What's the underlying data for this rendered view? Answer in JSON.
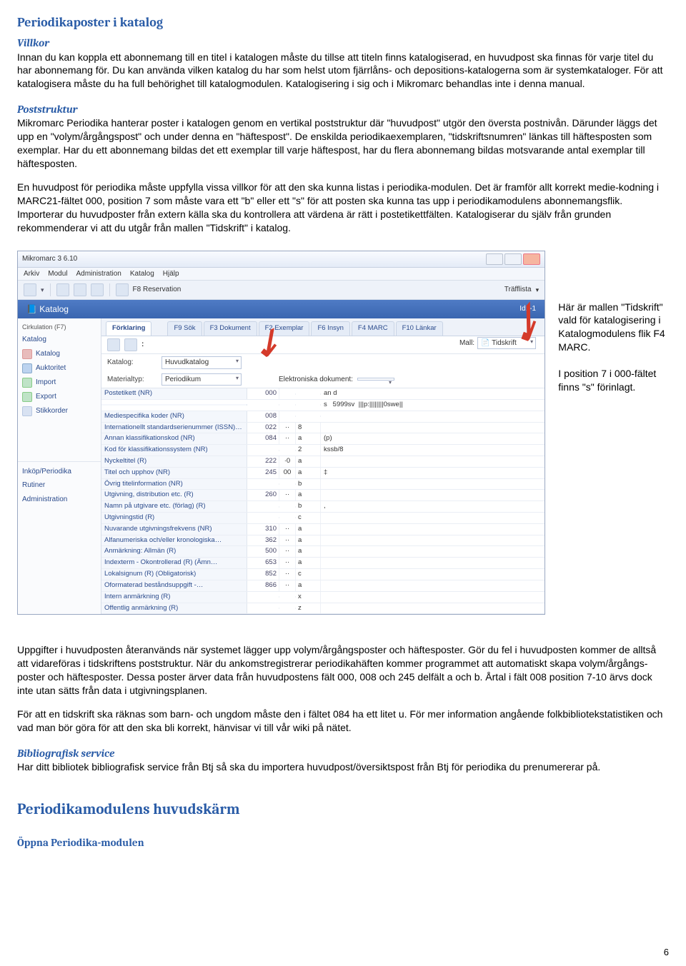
{
  "heading_main": "Periodikaposter i katalog",
  "villkor": {
    "heading": "Villkor",
    "para": "Innan du kan koppla ett abonnemang till en titel i katalogen måste du tillse att titeln finns katalogiserad, en huvudpost ska finnas för varje titel du har abonnemang för. Du kan använda vilken katalog du har som helst utom fjärrlåns- och depositions-katalogerna som är systemkataloger. För att katalogisera måste du ha full behörighet till katalogmodulen. Katalogisering i sig och i Mikromarc behandlas inte i denna manual."
  },
  "poststruktur": {
    "heading": "Poststruktur",
    "p1": "Mikromarc Periodika hanterar poster i katalogen genom en vertikal poststruktur där \"huvudpost\" utgör den översta postnivån. Därunder läggs det upp en \"volym/årgångspost\" och under denna en \"häftespost\". De enskilda periodikaexemplaren, \"tidskriftsnumren\" länkas till häftesposten som exemplar. Har du ett abonnemang bildas det ett exemplar till varje häftespost, har du flera abonnemang bildas motsvarande antal exemplar till häftesposten.",
    "p2": "En huvudpost för periodika måste uppfylla vissa villkor för att den ska kunna listas i periodika-modulen. Det är framför allt korrekt medie-kodning i MARC21-fältet 000, position 7 som måste vara ett \"b\" eller ett \"s\" för att posten ska kunna tas upp i periodikamodulens abonnemangsflik. Importerar du huvudposter från extern källa ska du kontrollera att värdena är rätt i postetikettfälten. Katalogiserar du själv från grunden rekommenderar vi att du utgår från mallen \"Tidskrift\" i katalog."
  },
  "side_notes": {
    "n1": "Här är mallen \"Tidskrift\" vald för katalogisering i Katalogmodulens flik F4 MARC.",
    "n2": "I position 7 i 000-fältet finns \"s\" förinlagt."
  },
  "below": {
    "p1": "Uppgifter i huvudposten återanvänds när systemet lägger upp volym/årgångsposter och häftesposter. Gör du fel i huvudposten kommer de alltså att vidareföras i tidskriftens poststruktur. När du ankomstregistrerar periodikahäften kommer programmet att automatiskt skapa volym/årgångs-poster och häftesposter. Dessa poster ärver data från huvudpostens fält 000, 008 och 245 delfält a och b. Årtal i fält 008 position 7-10 ärvs dock inte utan sätts från data i utgivningsplanen.",
    "p2": "För att en tidskrift ska räknas som barn- och ungdom måste den i fältet 084 ha ett litet u. För mer information angående folkbibliotekstatistiken och vad man bör göra för att den ska bli korrekt, hänvisar vi till vår wiki på nätet."
  },
  "biblio": {
    "heading": "Bibliografisk service",
    "p": "Har ditt bibliotek bibliografisk service från Btj så ska du importera huvudpost/översiktspost från Btj för periodika du prenumererar på."
  },
  "section2": {
    "heading": "Periodikamodulens huvudskärm",
    "sub": "Öppna Periodika-modulen"
  },
  "app": {
    "title": "Mikromarc 3 6.10",
    "menus": [
      "Arkiv",
      "Modul",
      "Administration",
      "Katalog",
      "Hjälp"
    ],
    "toolbar": {
      "f8": "F8 Reservation",
      "traff": "Träfflista"
    },
    "katalog_header_left": "Katalog",
    "katalog_header_right": "Id: -1",
    "sidebar_top_label": "Cirkulation (F7)",
    "sidebar_items": [
      "Katalog",
      "Katalog",
      "Auktoritet",
      "Import",
      "Export",
      "Stikkorder"
    ],
    "sidebar_bottom": [
      "Inköp/Periodika",
      "Rutiner",
      "Administration"
    ],
    "tab_first": "Förklaring",
    "tabs": [
      "F9 Sök",
      "F3 Dokument",
      "F2 Exemplar",
      "F6 Insyn",
      "F4 MARC",
      "F10 Länkar"
    ],
    "form": {
      "katalog_lbl": "Katalog:",
      "katalog_val": "Huvudkatalog",
      "mat_lbl": "Materialtyp:",
      "mat_val": "Periodikum",
      "edok_lbl": "Elektroniska dokument:",
      "mall_lbl": "Mall:",
      "mall_val": "Tidskrift"
    },
    "grid": [
      {
        "name": "Postetikett (NR)",
        "tag": "000",
        "ind": "",
        "s": "",
        "sub": "an d"
      },
      {
        "name": "",
        "tag": "",
        "ind": "",
        "s": "",
        "sub": "s ‎ ‎ ‎5999sv ‎ |||p:||||||||0swe||"
      },
      {
        "name": "Mediespecifika koder (NR)",
        "tag": "008",
        "ind": "",
        "s": "",
        "sub": ""
      },
      {
        "name": "Internationellt standardserienummer (ISSN)…",
        "tag": "022",
        "ind": "··",
        "s": "8",
        "sub": ""
      },
      {
        "name": "Annan klassifikationskod (NR)",
        "tag": "084",
        "ind": "··",
        "s": "a",
        "sub": "(p)"
      },
      {
        "name": "Kod för klassifikationssystem (NR)",
        "tag": "",
        "ind": "",
        "s": "2",
        "sub": "kssb/8"
      },
      {
        "name": "Nyckeltitel (R)",
        "tag": "222",
        "ind": "·0",
        "s": "a",
        "sub": ""
      },
      {
        "name": "Titel och upphov (NR)",
        "tag": "245",
        "ind": "00",
        "s": "a",
        "sub": "‡"
      },
      {
        "name": "Övrig titelinformation (NR)",
        "tag": "",
        "ind": "",
        "s": "b",
        "sub": ""
      },
      {
        "name": "Utgivning, distribution etc. (R)",
        "tag": "260",
        "ind": "··",
        "s": "a",
        "sub": ""
      },
      {
        "name": "Namn på utgivare etc. (förlag) (R)",
        "tag": "",
        "ind": "",
        "s": "b",
        "sub": ","
      },
      {
        "name": "Utgivningstid (R)",
        "tag": "",
        "ind": "",
        "s": "c",
        "sub": ""
      },
      {
        "name": "Nuvarande utgivningsfrekvens (NR)",
        "tag": "310",
        "ind": "··",
        "s": "a",
        "sub": ""
      },
      {
        "name": "Alfanumeriska och/eller kronologiska…",
        "tag": "362",
        "ind": "··",
        "s": "a",
        "sub": ""
      },
      {
        "name": "Anmärkning: Allmän (R)",
        "tag": "500",
        "ind": "··",
        "s": "a",
        "sub": ""
      },
      {
        "name": "Indexterm - Okontrollerad (R) (Ämn…",
        "tag": "653",
        "ind": "··",
        "s": "a",
        "sub": ""
      },
      {
        "name": "Lokalsignum (R) (Obligatorisk)",
        "tag": "852",
        "ind": "··",
        "s": "c",
        "sub": ""
      },
      {
        "name": "Oformaterad beståndsuppgift -…",
        "tag": "866",
        "ind": "··",
        "s": "a",
        "sub": ""
      },
      {
        "name": "Intern anmärkning (R)",
        "tag": "",
        "ind": "",
        "s": "x",
        "sub": ""
      },
      {
        "name": "Offentlig anmärkning (R)",
        "tag": "",
        "ind": "",
        "s": "z",
        "sub": ""
      }
    ]
  },
  "page_number": "6"
}
